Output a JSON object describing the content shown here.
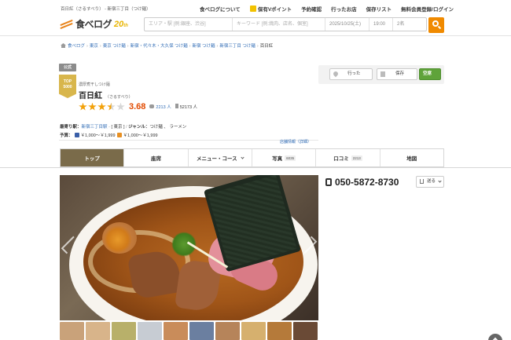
{
  "topbar": {
    "breadcrumb": "百日紅（さるすべり） - 新宿三丁目（つけ麺）",
    "links": [
      "食べログについて",
      "保有Vポイント",
      "予約確認",
      "行ったお店",
      "保存リスト",
      "無料会員登録/ログイン"
    ]
  },
  "header": {
    "logo_text": "食べログ",
    "anniversary": "20",
    "anniversary_suffix": "th",
    "search": {
      "area_placeholder": "エリア・駅 [例:銀座、渋谷]",
      "keyword_placeholder": "キーワード [例:焼肉、店名、個室]",
      "date": "2025/10/25(土)",
      "time": "19:00",
      "people": "2名"
    }
  },
  "breadcrumbs": [
    "食べログ",
    "東京",
    "東京 つけ麺",
    "新宿・代々木・大久保 つけ麺",
    "新宿 つけ麺",
    "新宿三丁目 つけ麺",
    "百日紅"
  ],
  "shop": {
    "official_badge": "公式",
    "top_badge": "TOP\n5000",
    "genre_tag": "濃厚煮干しつけ麺",
    "name": "百日紅",
    "kana": "（さるすべり）",
    "score": "3.68",
    "stars": 3.5,
    "review_count": "2213",
    "review_unit": "人",
    "bookmark_count": "52173",
    "bookmark_unit": "人",
    "nearest_label": "最寄り駅：",
    "nearest_station": "新宿三丁目駅",
    "area_label": "[ 東京 ]",
    "genre_label": "ジャンル：",
    "genre_value": "つけ麺 、 ラーメン",
    "budget_label": "予算：",
    "budget_night": "￥1,000～￥1,999",
    "budget_lunch": "￥1,000～￥1,999",
    "update_link": "店舗情報（詳細）"
  },
  "actions": {
    "went": "行った",
    "save": "保存",
    "reserve": "空席"
  },
  "tabs": [
    {
      "label": "トップ",
      "active": true
    },
    {
      "label": "座席"
    },
    {
      "label": "メニュー・コース",
      "dropdown": true
    },
    {
      "label": "写真",
      "count": "6035"
    },
    {
      "label": "口コミ",
      "count": "2213"
    },
    {
      "label": "地図"
    }
  ],
  "contact": {
    "phone": "050-5872-8730",
    "send_label": "送る"
  },
  "thumb_colors": [
    "#c9a27a",
    "#d8b48a",
    "#b8b06a",
    "#c7ccd3",
    "#c98c5a",
    "#6b7fa0",
    "#b6845a",
    "#d6b06e",
    "#b57a3a",
    "#6a4a36"
  ]
}
